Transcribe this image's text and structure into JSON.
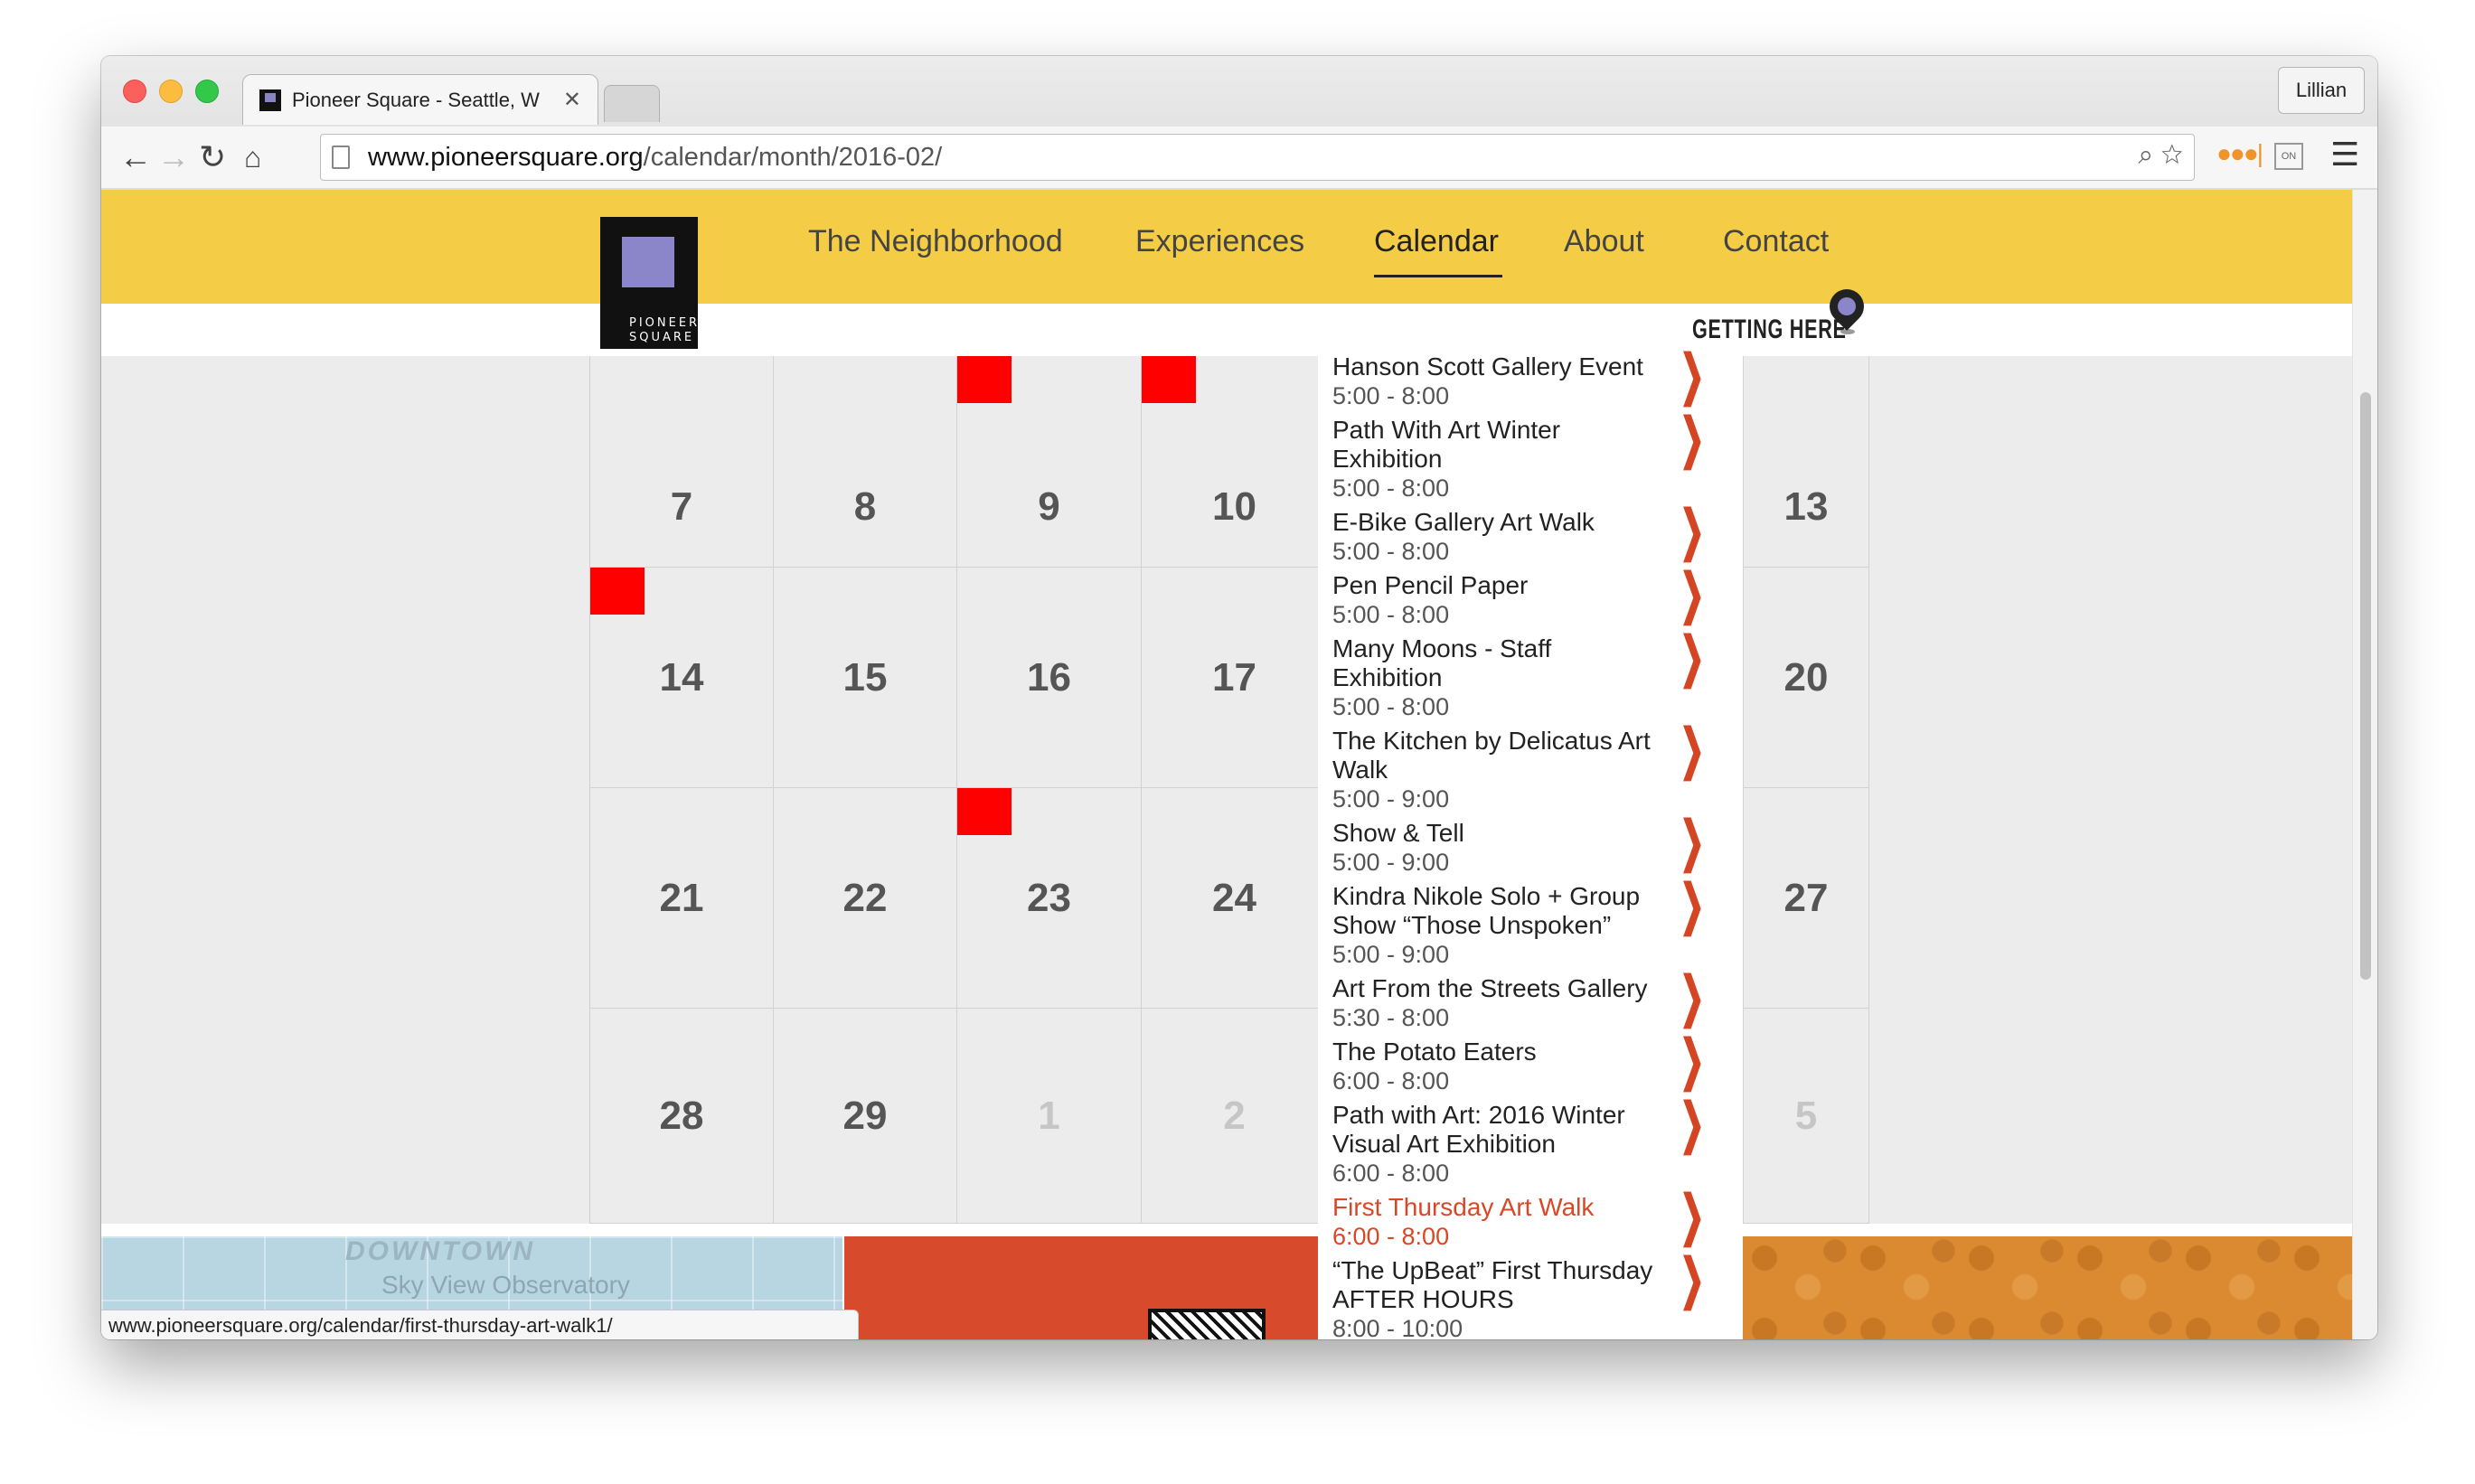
{
  "browser": {
    "tab_title": "Pioneer Square - Seattle, W",
    "profile_name": "Lillian",
    "url_host": "www.pioneersquare.org",
    "url_path": "/calendar/month/2016-02/",
    "status_url": "www.pioneersquare.org/calendar/first-thursday-art-walk1/"
  },
  "site": {
    "logo_text_line1": "PIONEER",
    "logo_text_line2": "SQUARE",
    "nav": [
      "The Neighborhood",
      "Experiences",
      "Calendar",
      "About",
      "Contact"
    ],
    "active_nav": "Calendar",
    "getting_here": "GETTING HERE",
    "accent_color": "#f4cc46",
    "event_flag_color": "#ff0000",
    "highlight_color": "#d84826"
  },
  "calendar": {
    "rows": [
      [
        {
          "day": "7"
        },
        {
          "day": "8"
        },
        {
          "day": "9",
          "has_event": true
        },
        {
          "day": "10",
          "has_event": true
        }
      ],
      [
        {
          "day": "14",
          "has_event": true
        },
        {
          "day": "15"
        },
        {
          "day": "16"
        },
        {
          "day": "17"
        }
      ],
      [
        {
          "day": "21"
        },
        {
          "day": "22"
        },
        {
          "day": "23",
          "has_event": true
        },
        {
          "day": "24"
        }
      ],
      [
        {
          "day": "28"
        },
        {
          "day": "29"
        },
        {
          "day": "1",
          "muted": true
        },
        {
          "day": "2",
          "muted": true
        }
      ]
    ],
    "right_column": [
      {
        "day": "13"
      },
      {
        "day": "20"
      },
      {
        "day": "27"
      },
      {
        "day": "5",
        "muted": true
      }
    ]
  },
  "events": [
    {
      "title": "Hanson Scott Gallery Event",
      "time": "5:00 - 8:00"
    },
    {
      "title": "Path With Art Winter Exhibition",
      "time": "5:00 - 8:00"
    },
    {
      "title": "E-Bike Gallery Art Walk",
      "time": "5:00 - 8:00"
    },
    {
      "title": "Pen Pencil Paper",
      "time": "5:00 - 8:00"
    },
    {
      "title": "Many Moons - Staff Exhibition",
      "time": "5:00 - 8:00"
    },
    {
      "title": "The Kitchen by Delicatus Art Walk",
      "time": "5:00 - 9:00"
    },
    {
      "title": "Show & Tell",
      "time": "5:00 - 9:00"
    },
    {
      "title": "Kindra Nikole Solo + Group Show “Those Unspoken”",
      "time": "5:00 - 9:00"
    },
    {
      "title": "Art From the Streets Gallery",
      "time": "5:30 - 8:00"
    },
    {
      "title": "The Potato Eaters",
      "time": "6:00 - 8:00"
    },
    {
      "title": "Path with Art: 2016 Winter Visual Art Exhibition",
      "time": "6:00 - 8:00"
    },
    {
      "title": "First Thursday Art Walk",
      "time": "6:00 - 8:00",
      "highlight": true
    },
    {
      "title": "“The UpBeat” First Thursday AFTER HOURS",
      "time": "8:00 - 10:00"
    }
  ],
  "map": {
    "label_downtown": "DOWNTOWN",
    "label_sky_view": "Sky View Observatory"
  }
}
